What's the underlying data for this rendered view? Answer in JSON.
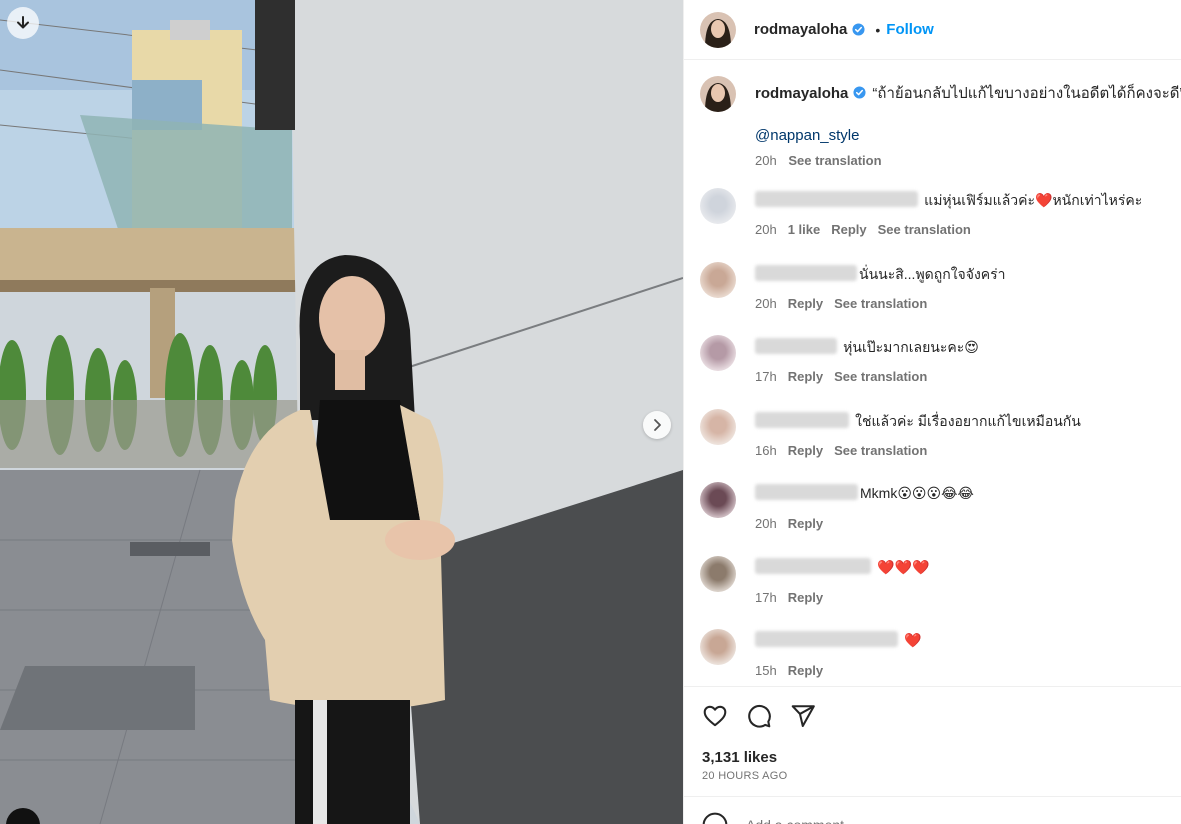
{
  "post": {
    "username": "rodmayaloha",
    "follow_label": "Follow",
    "separator": "•"
  },
  "caption": {
    "username": "rodmayaloha",
    "text": "“ถ้าย้อนกลับไปแก้ไขบางอย่างในอดีตได้ก็คงจะดี”",
    "mention": "@nappan_style",
    "time": "20h",
    "see_translation": "See translation"
  },
  "comments": [
    {
      "text": "แม่หุ่นเฟิร์มแล้วค่ะ❤️หนักเท่าไหร่คะ",
      "time": "20h",
      "likes": "1 like",
      "reply": "Reply",
      "translate": "See translation"
    },
    {
      "text": "นั่นนะสิ...พูดถูกใจจังคร่า",
      "time": "20h",
      "reply": "Reply",
      "translate": "See translation"
    },
    {
      "text": "หุ่นเป๊ะมากเลยนะคะ😍",
      "time": "17h",
      "reply": "Reply",
      "translate": "See translation"
    },
    {
      "text": "ใช่แล้วค่ะ มีเรื่องอยากแก้ไขเหมือนกัน",
      "time": "16h",
      "reply": "Reply",
      "translate": "See translation"
    },
    {
      "text": "Mkmk😮😮😮😂😂",
      "time": "20h",
      "reply": "Reply"
    },
    {
      "text": "❤️❤️❤️",
      "time": "17h",
      "reply": "Reply"
    },
    {
      "text": "❤️",
      "time": "15h",
      "reply": "Reply"
    }
  ],
  "stats": {
    "likes": "3,131 likes",
    "time_ago": "20 HOURS AGO"
  },
  "add_comment": {
    "placeholder": "Add a comment..."
  },
  "icons": {
    "download": "download-icon",
    "next": "chevron-right-icon",
    "verified": "verified-badge-icon",
    "like": "heart-icon",
    "comment": "comment-icon",
    "share": "share-icon",
    "emoji": "emoji-icon"
  },
  "colors": {
    "follow": "#0095f6",
    "verified": "#3897f0",
    "mention": "#00376b",
    "secondary_text": "#737373"
  }
}
